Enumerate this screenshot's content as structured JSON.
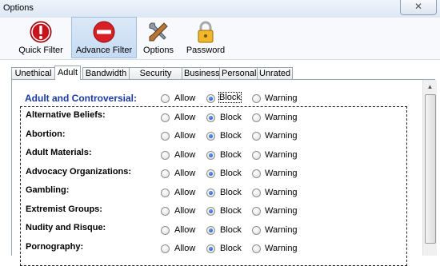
{
  "window": {
    "title": "Options",
    "close_glyph": "✕"
  },
  "toolbar": {
    "buttons": [
      {
        "label": "Quick Filter",
        "icon": "stop-icon"
      },
      {
        "label": "Advance Filter",
        "icon": "no-entry-icon",
        "active": true
      },
      {
        "label": "Options",
        "icon": "tools-icon"
      },
      {
        "label": "Password",
        "icon": "padlock-icon"
      }
    ]
  },
  "tabs": [
    "Unethical",
    "Adult",
    "Bandwidth",
    "Security Risk",
    "Business",
    "Personal",
    "Unrated"
  ],
  "selected_tab": "Adult",
  "options": {
    "allow": "Allow",
    "block": "Block",
    "warning": "Warning"
  },
  "group": {
    "label": "Adult and Controversial:",
    "selected": "Block"
  },
  "categories": [
    {
      "label": "Alternative Beliefs:",
      "selected": "Block"
    },
    {
      "label": "Abortion:",
      "selected": "Block"
    },
    {
      "label": "Adult Materials:",
      "selected": "Block"
    },
    {
      "label": "Advocacy Organizations:",
      "selected": "Block"
    },
    {
      "label": "Gambling:",
      "selected": "Block"
    },
    {
      "label": "Extremist Groups:",
      "selected": "Block"
    },
    {
      "label": "Nudity and Risque:",
      "selected": "Block"
    },
    {
      "label": "Pornography:",
      "selected": "Block"
    }
  ],
  "colors": {
    "group_label": "#1a3aa0",
    "radio_dot": "#0b3ea8",
    "active_toolbar": "#c6dbf3"
  }
}
